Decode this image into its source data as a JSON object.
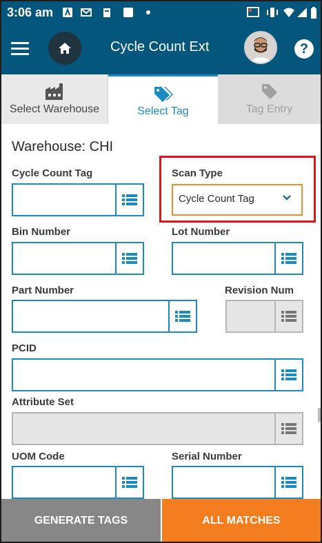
{
  "status_bar": {
    "time": "3:06 am"
  },
  "app_bar": {
    "title": "Cycle Count Ext",
    "help": "?"
  },
  "tabs": [
    {
      "label": "Select Warehouse"
    },
    {
      "label": "Select Tag"
    },
    {
      "label": "Tag Entry"
    }
  ],
  "form": {
    "warehouse": "Warehouse: CHI",
    "cycle_count_tag": {
      "label": "Cycle Count Tag",
      "value": ""
    },
    "scan_type": {
      "label": "Scan Type",
      "value": "Cycle Count Tag"
    },
    "bin_number": {
      "label": "Bin Number",
      "value": ""
    },
    "lot_number": {
      "label": "Lot Number",
      "value": ""
    },
    "part_number": {
      "label": "Part Number",
      "value": ""
    },
    "revision_num": {
      "label": "Revision Num",
      "value": ""
    },
    "pcid": {
      "label": "PCID",
      "value": ""
    },
    "attribute_set": {
      "label": "Attribute Set",
      "value": ""
    },
    "uom_code": {
      "label": "UOM Code",
      "value": ""
    },
    "serial_number": {
      "label": "Serial Number",
      "value": ""
    }
  },
  "actions": {
    "generate_tags": "GENERATE TAGS",
    "all_matches": "ALL MATCHES"
  },
  "colors": {
    "primary": "#05567d",
    "accent": "#1b8bbf",
    "orange": "#f47d20",
    "highlight": "#e0141e"
  }
}
